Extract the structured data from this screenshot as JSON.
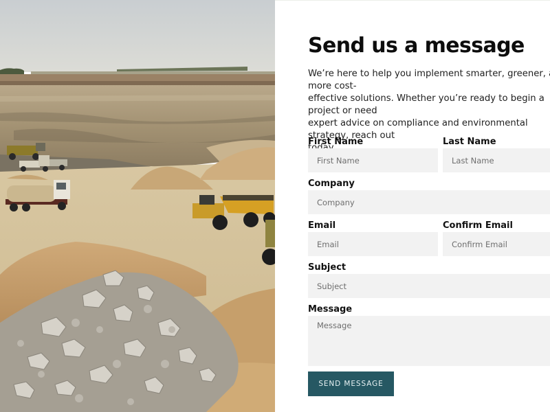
{
  "photo": {
    "alt": "Open-pit quarry with haul trucks, a water tanker and piles of crushed rock"
  },
  "form": {
    "title": "Send us a message",
    "intro": "We’re here to help you implement smarter, greener, and more cost-\neffective solutions. Whether you’re ready to begin a project or need\nexpert advice on compliance and environmental strategy, reach out\ntoday.",
    "first_name": {
      "label": "First Name",
      "placeholder": "First Name",
      "value": ""
    },
    "last_name": {
      "label": "Last Name",
      "placeholder": "Last Name",
      "value": ""
    },
    "company": {
      "label": "Company",
      "placeholder": "Company",
      "value": ""
    },
    "email": {
      "label": "Email",
      "placeholder": "Email",
      "value": ""
    },
    "confirm_email": {
      "label": "Confirm Email",
      "placeholder": "Confirm Email",
      "value": ""
    },
    "subject": {
      "label": "Subject",
      "placeholder": "Subject",
      "value": ""
    },
    "message": {
      "label": "Message",
      "placeholder": "Message",
      "value": ""
    },
    "submit_label": "SEND MESSAGE"
  },
  "colors": {
    "button_bg": "#265863",
    "field_bg": "#f2f2f2",
    "heading": "#0d0d0d"
  }
}
